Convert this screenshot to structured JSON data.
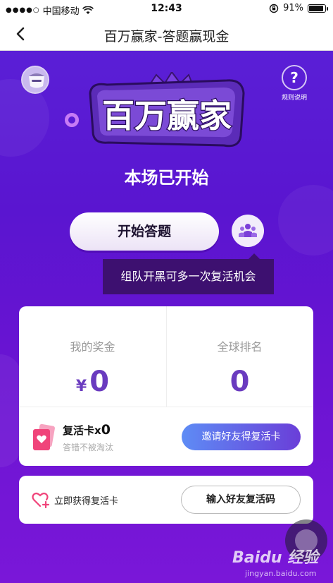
{
  "status_bar": {
    "signal": "●●●●○",
    "carrier": "中国移动",
    "time": "12:43",
    "battery": "91%"
  },
  "nav": {
    "title": "百万赢家-答题赢现金"
  },
  "header": {
    "logo_text": "百万赢家",
    "rules_icon": "?",
    "rules_label": "规则说明"
  },
  "game": {
    "status": "本场已开始",
    "start_label": "开始答题",
    "team_tooltip": "组队开黑可多一次复活机会"
  },
  "stats": {
    "prize_label": "我的奖金",
    "currency": "¥",
    "prize_value": "0",
    "rank_label": "全球排名",
    "rank_value": "0"
  },
  "revive": {
    "title": "复活卡",
    "multiplier": "x",
    "count": "0",
    "subtitle": "答错不被淘汰",
    "invite_label": "邀请好友得复活卡"
  },
  "code": {
    "label": "立即获得复活卡",
    "button_label": "输入好友复活码"
  },
  "watermark": {
    "brand": "Baidu 经验",
    "url": "jingyan.baidu.com"
  },
  "colors": {
    "purple": "#5a15d0",
    "accent": "#6a3bbf",
    "pink": "#f0447a"
  }
}
